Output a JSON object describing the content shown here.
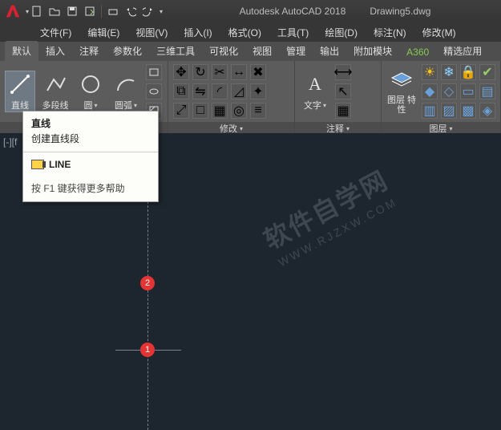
{
  "title": {
    "app": "Autodesk AutoCAD 2018",
    "file": "Drawing5.dwg"
  },
  "menu": [
    "文件(F)",
    "编辑(E)",
    "视图(V)",
    "插入(I)",
    "格式(O)",
    "工具(T)",
    "绘图(D)",
    "标注(N)",
    "修改(M)"
  ],
  "ribtabs": [
    "默认",
    "插入",
    "注释",
    "参数化",
    "三维工具",
    "可视化",
    "视图",
    "管理",
    "输出",
    "附加模块",
    "A360",
    "精选应用"
  ],
  "panels": {
    "draw": {
      "line": "直线",
      "pline": "多段线",
      "circle": "圆",
      "arc": "圆弧"
    },
    "modify": {
      "title": "修改"
    },
    "annot": {
      "title": "注释",
      "text": "文字"
    },
    "layer": {
      "title": "图层",
      "props": "图层\n特性"
    }
  },
  "dropdown_glyph": "▾",
  "tooltip": {
    "title": "直线",
    "sub": "创建直线段",
    "cmd": "LINE",
    "help": "按 F1 键获得更多帮助"
  },
  "viewport_label": "[-][f",
  "markers": {
    "m1": "1",
    "m2": "2"
  },
  "watermark": {
    "line1": "软件自学网",
    "line2": "WWW.RJZXW.COM"
  }
}
